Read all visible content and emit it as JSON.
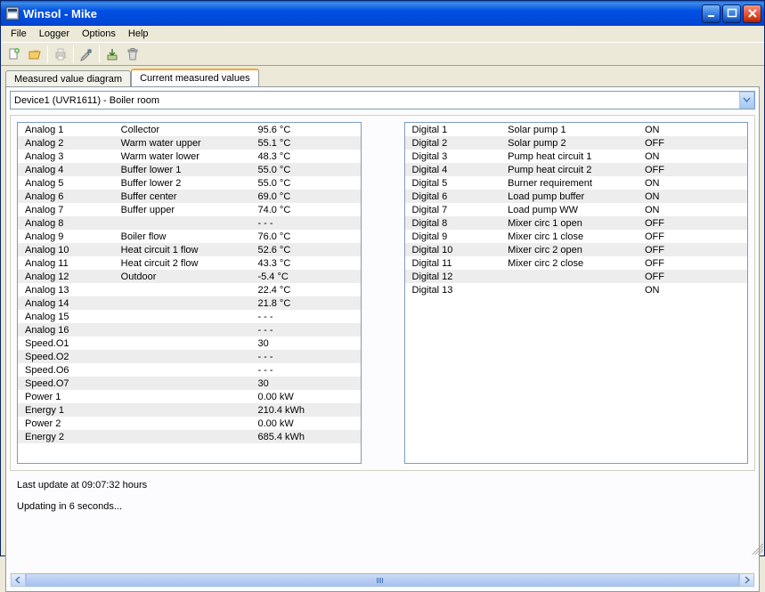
{
  "window": {
    "title": "Winsol - Mike"
  },
  "menu": {
    "items": [
      "File",
      "Logger",
      "Options",
      "Help"
    ]
  },
  "tabs": {
    "items": [
      "Measured value diagram",
      "Current measured values"
    ],
    "active": 1
  },
  "device_dropdown": {
    "selected": "Device1 (UVR1611) - Boiler room"
  },
  "analog_rows": [
    {
      "name": "Analog 1",
      "label": "Collector",
      "value": "95.6 °C"
    },
    {
      "name": "Analog 2",
      "label": "Warm water upper",
      "value": "55.1 °C"
    },
    {
      "name": "Analog 3",
      "label": "Warm water lower",
      "value": "48.3 °C"
    },
    {
      "name": "Analog 4",
      "label": "Buffer lower 1",
      "value": "55.0 °C"
    },
    {
      "name": "Analog 5",
      "label": "Buffer lower 2",
      "value": "55.0 °C"
    },
    {
      "name": "Analog 6",
      "label": "Buffer center",
      "value": "69.0 °C"
    },
    {
      "name": "Analog 7",
      "label": "Buffer upper",
      "value": "74.0 °C"
    },
    {
      "name": "Analog 8",
      "label": "",
      "value": "- - -"
    },
    {
      "name": "Analog 9",
      "label": "Boiler flow",
      "value": "76.0 °C"
    },
    {
      "name": "Analog 10",
      "label": "Heat circuit 1 flow",
      "value": "52.6 °C"
    },
    {
      "name": "Analog 11",
      "label": "Heat circuit 2 flow",
      "value": "43.3 °C"
    },
    {
      "name": "Analog 12",
      "label": "Outdoor",
      "value": "-5.4 °C"
    },
    {
      "name": "Analog 13",
      "label": "",
      "value": "22.4 °C"
    },
    {
      "name": "Analog 14",
      "label": "",
      "value": "21.8 °C"
    },
    {
      "name": "Analog 15",
      "label": "",
      "value": "- - -"
    },
    {
      "name": "Analog 16",
      "label": "",
      "value": "- - -"
    },
    {
      "name": "Speed.O1",
      "label": "",
      "value": "30"
    },
    {
      "name": "Speed.O2",
      "label": "",
      "value": "- - -"
    },
    {
      "name": "Speed.O6",
      "label": "",
      "value": "- - -"
    },
    {
      "name": "Speed.O7",
      "label": "",
      "value": "30"
    },
    {
      "name": "Power 1",
      "label": "",
      "value": "0.00 kW"
    },
    {
      "name": "Energy 1",
      "label": "",
      "value": "210.4 kWh"
    },
    {
      "name": "Power 2",
      "label": "",
      "value": "0.00 kW"
    },
    {
      "name": "Energy 2",
      "label": "",
      "value": "685.4 kWh"
    }
  ],
  "digital_rows": [
    {
      "name": "Digital 1",
      "label": "Solar pump 1",
      "value": "ON"
    },
    {
      "name": "Digital 2",
      "label": "Solar pump 2",
      "value": "OFF"
    },
    {
      "name": "Digital 3",
      "label": "Pump heat circuit 1",
      "value": "ON"
    },
    {
      "name": "Digital 4",
      "label": "Pump heat circuit 2",
      "value": "OFF"
    },
    {
      "name": "Digital 5",
      "label": "Burner requirement",
      "value": "ON"
    },
    {
      "name": "Digital 6",
      "label": "Load pump buffer",
      "value": "ON"
    },
    {
      "name": "Digital 7",
      "label": "Load pump WW",
      "value": "ON"
    },
    {
      "name": "Digital 8",
      "label": "Mixer circ 1 open",
      "value": "OFF"
    },
    {
      "name": "Digital 9",
      "label": "Mixer circ 1 close",
      "value": "OFF"
    },
    {
      "name": "Digital 10",
      "label": "Mixer circ 2 open",
      "value": "OFF"
    },
    {
      "name": "Digital 11",
      "label": "Mixer circ 2 close",
      "value": "OFF"
    },
    {
      "name": "Digital 12",
      "label": "",
      "value": "OFF"
    },
    {
      "name": "Digital 13",
      "label": "",
      "value": "ON"
    }
  ],
  "status": {
    "last_update": "Last update at 09:07:32 hours",
    "next_update": "Updating in 6 seconds..."
  }
}
